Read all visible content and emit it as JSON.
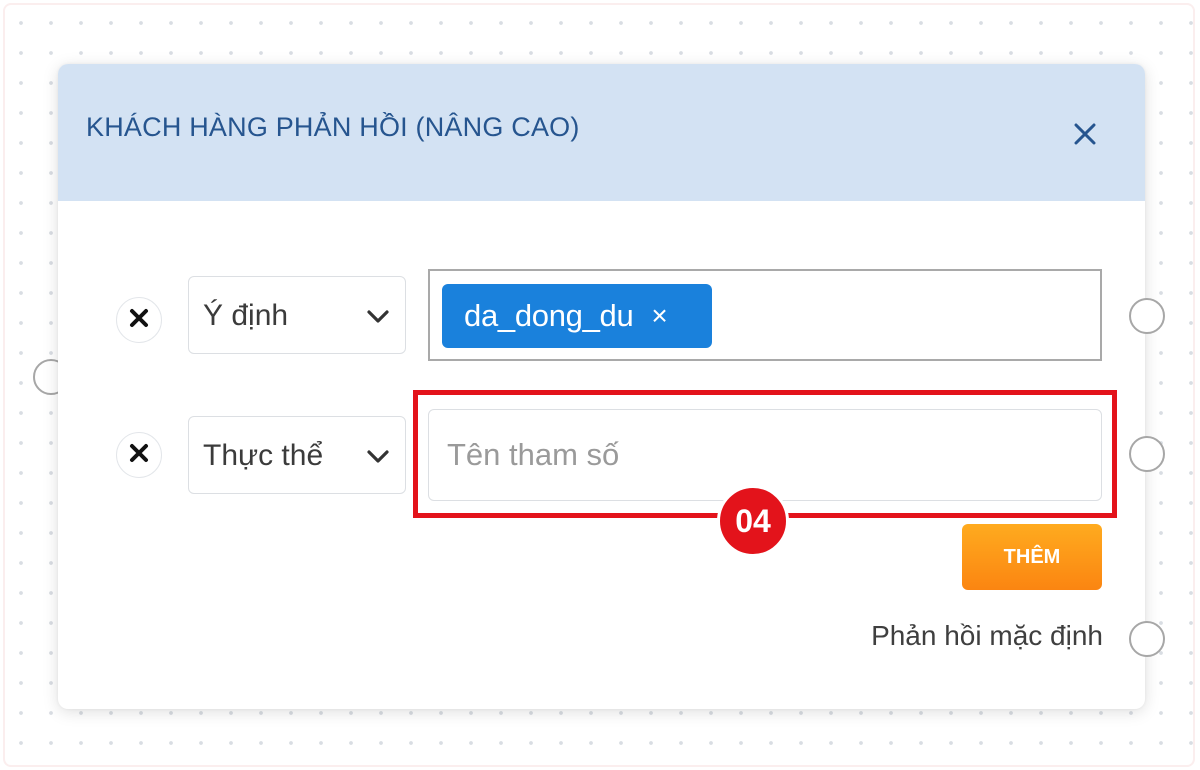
{
  "node": {
    "title": "KHÁCH HÀNG PHẢN HỒI (NÂNG CAO)",
    "close_icon": "close-icon"
  },
  "rows": [
    {
      "type_label": "Ý định",
      "tags": [
        {
          "label": "da_dong_du",
          "remove": "×"
        }
      ]
    },
    {
      "type_label": "Thực thể",
      "input_value": "",
      "input_placeholder": "Tên tham số"
    }
  ],
  "highlight": {
    "step": "04",
    "color": "#e3131b"
  },
  "add_button_label": "THÊM",
  "default_response_label": "Phản hồi mặc định",
  "colors": {
    "header_bg": "#d3e2f3",
    "title": "#26558f",
    "tag_bg": "#1a81dc",
    "add_button": "#fb8511"
  }
}
